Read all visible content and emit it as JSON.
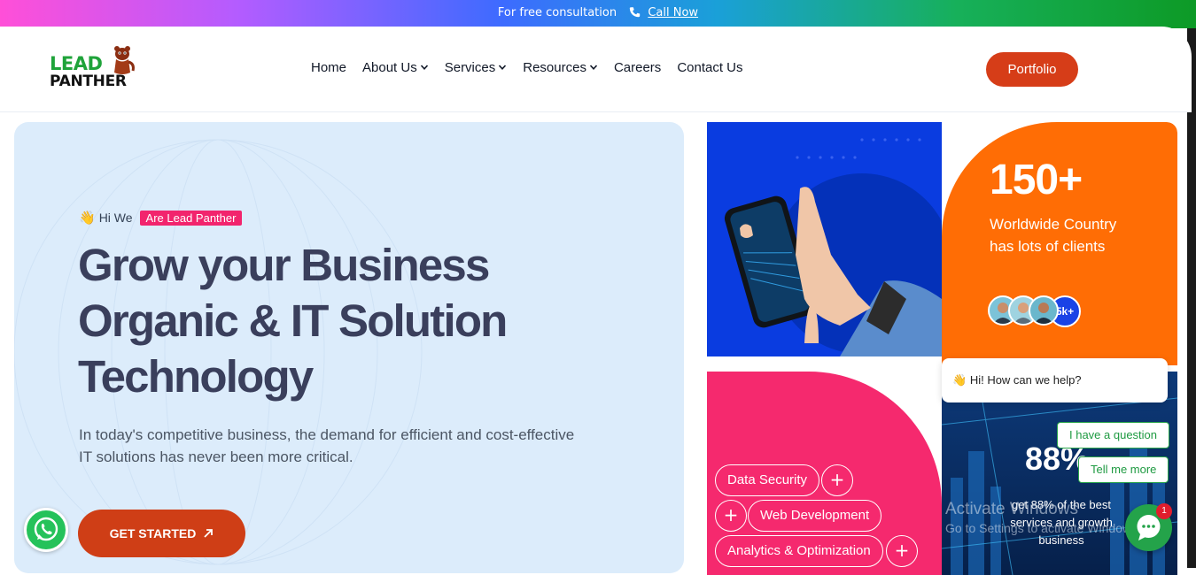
{
  "topbar": {
    "text": "For free consultation",
    "call_label": "Call Now"
  },
  "brand": {
    "line1": "LEAD",
    "line2": "PANTHER"
  },
  "nav": [
    {
      "label": "Home",
      "has_dropdown": false
    },
    {
      "label": "About Us",
      "has_dropdown": true
    },
    {
      "label": "Services",
      "has_dropdown": true
    },
    {
      "label": "Resources",
      "has_dropdown": true
    },
    {
      "label": "Careers",
      "has_dropdown": false
    },
    {
      "label": "Contact Us",
      "has_dropdown": false
    }
  ],
  "portfolio_label": "Portfolio",
  "hero": {
    "greeting": "Hi We",
    "greeting_icon": "waving-hand",
    "badge": "Are Lead Panther",
    "headline": [
      "Grow your Business",
      "Organic & IT Solution",
      "Technology"
    ],
    "lede_1": "In today's competitive business, the demand for efficient and cost-effective",
    "lede_2": "IT solutions has never been more critical.",
    "cta_label": "GET STARTED"
  },
  "stats": {
    "count": "150+",
    "desc_1": "Worldwide Country",
    "desc_2": "has lots of clients",
    "avatars_more": "5k+"
  },
  "services": {
    "pill_1": "Data Security",
    "pill_2": "Web Development",
    "pill_3": "Analytics & Optimization"
  },
  "tech": {
    "percent": "88%",
    "desc_1": "get 88% of the best",
    "desc_2": "services and growth",
    "desc_3": "business"
  },
  "chat": {
    "greeting": "Hi! How can we help?",
    "option_1": "I have a question",
    "option_2": "Tell me more",
    "unread": "1"
  },
  "watermark": {
    "line1": "Activate Windows",
    "line2": "Go to Settings to activate Windows."
  },
  "colors": {
    "accent": "#d63d18",
    "green": "#1fa33a",
    "pink": "#f5296e",
    "orange": "#ff6d05",
    "blue": "#0a3ce0"
  }
}
